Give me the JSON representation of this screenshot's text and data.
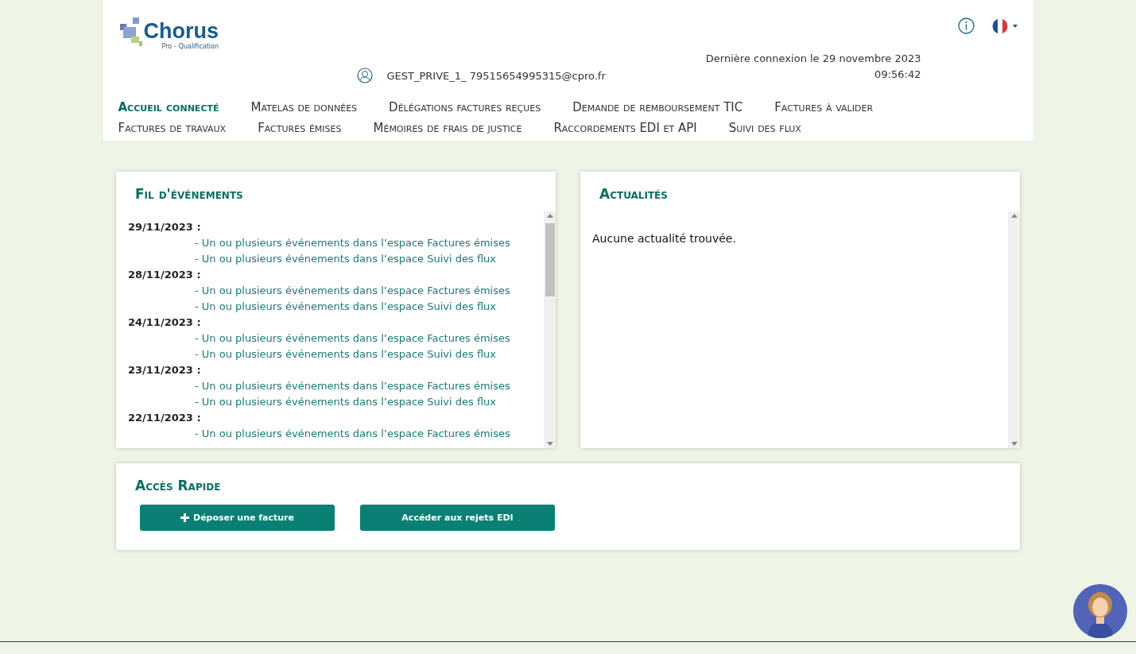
{
  "header": {
    "logo": {
      "name": "Chorus",
      "subtitle_prefix": "Pro -",
      "subtitle": "Qualification"
    },
    "user": "GEST_PRIVE_1_ 79515654995315@cpro.fr",
    "last_login": "Dernière connexion le 29 novembre 2023",
    "last_login_time": "09:56:42"
  },
  "nav": [
    {
      "label": "Accueil connecté",
      "selected": true
    },
    {
      "label": "Matelas de données",
      "selected": false
    },
    {
      "label": "Délégations factures reçues",
      "selected": false
    },
    {
      "label": "Demande de remboursement TIC",
      "selected": false
    },
    {
      "label": "Factures à valider",
      "selected": false
    },
    {
      "label": "Factures de travaux",
      "selected": false
    },
    {
      "label": "Factures émises",
      "selected": false
    },
    {
      "label": "Mémoires de frais de justice",
      "selected": false
    },
    {
      "label": "Raccordements EDI et API",
      "selected": false
    },
    {
      "label": "Suivi des flux",
      "selected": false
    }
  ],
  "events": {
    "title": "Fil d'événements",
    "groups": [
      {
        "date": "29/11/2023 :",
        "items": [
          "- Un ou plusieurs événements dans l’espace Factures émises",
          "- Un ou plusieurs événements dans l’espace Suivi des flux"
        ]
      },
      {
        "date": "28/11/2023 :",
        "items": [
          "- Un ou plusieurs événements dans l’espace Factures émises",
          "- Un ou plusieurs événements dans l’espace Suivi des flux"
        ]
      },
      {
        "date": "24/11/2023 :",
        "items": [
          "- Un ou plusieurs événements dans l’espace Factures émises",
          "- Un ou plusieurs événements dans l’espace Suivi des flux"
        ]
      },
      {
        "date": "23/11/2023 :",
        "items": [
          "- Un ou plusieurs événements dans l’espace Factures émises",
          "- Un ou plusieurs événements dans l’espace Suivi des flux"
        ]
      },
      {
        "date": "22/11/2023 :",
        "items": [
          "- Un ou plusieurs événements dans l’espace Factures émises"
        ]
      }
    ]
  },
  "news": {
    "title": "Actualités",
    "empty": "Aucune actualité trouvée."
  },
  "quick_access": {
    "title": "Accès Rapide",
    "buttons": [
      {
        "label": "Déposer une facture",
        "kind": "add"
      },
      {
        "label": "Accéder aux rejets EDI",
        "kind": "plain"
      }
    ]
  }
}
